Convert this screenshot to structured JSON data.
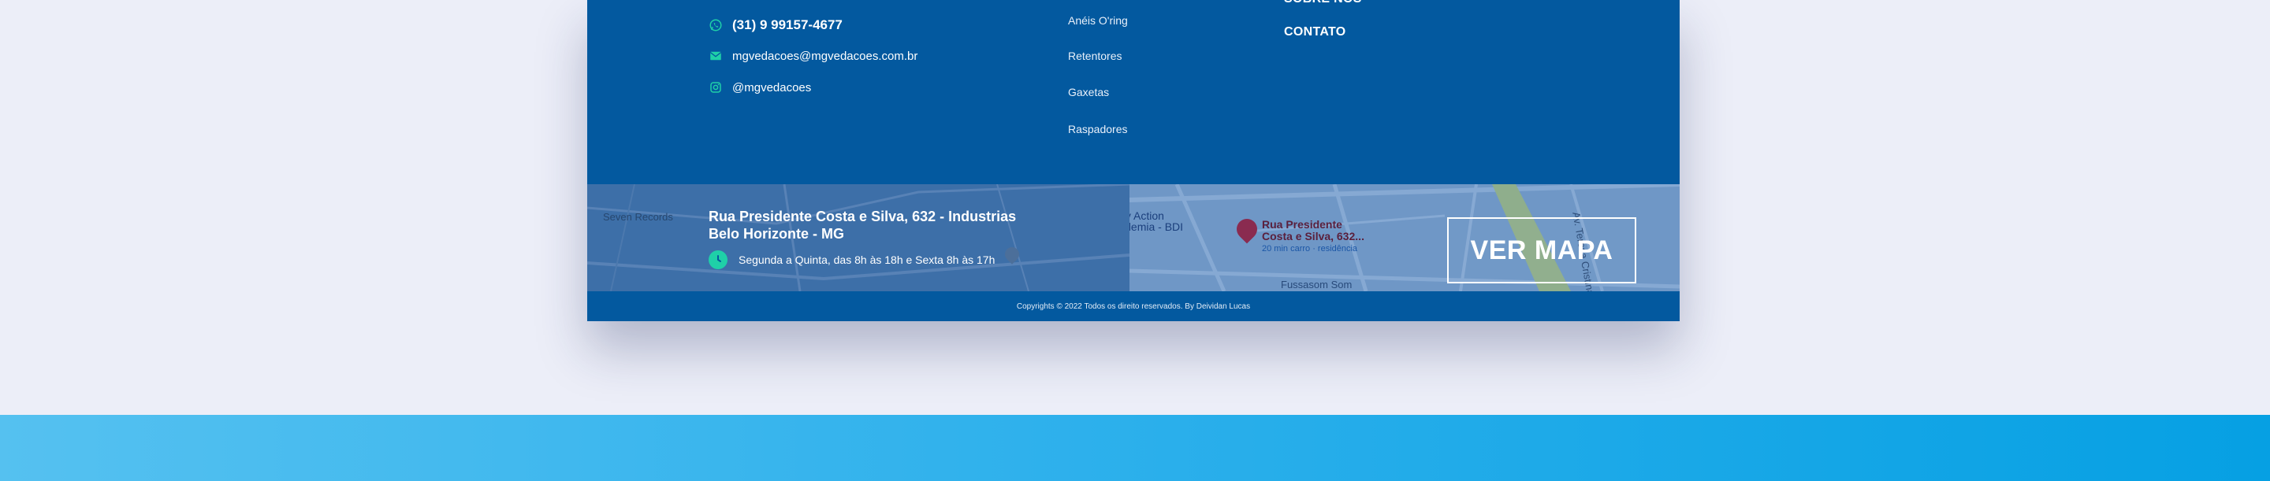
{
  "contacts": {
    "phone": "(31) 9 99157-4677",
    "email": "mgvedacoes@mgvedacoes.com.br",
    "instagram": "@mgvedacoes"
  },
  "products": [
    "Anéis O'ring",
    "Retentores",
    "Gaxetas",
    "Raspadores"
  ],
  "institutional": {
    "cut_label": "SOBRE NÓS",
    "contact_label": "CONTATO"
  },
  "location": {
    "address_line1": "Rua Presidente Costa e Silva, 632 - Industrias",
    "address_line2": "Belo Horizonte - MG",
    "hours": "Segunda a Quinta, das 8h às 18h e Sexta 8h às 17h"
  },
  "map": {
    "place_line1": "Rua Presidente",
    "place_line2": "Costa e Silva, 632...",
    "place_sub": "20 min carro · residência",
    "poi1": "Seven Records",
    "poi2": "Body Action",
    "poi3": "Academia - BDI",
    "road1": "Fussasom Som",
    "road2": "Av. Teresa Cristina",
    "button_label": "VER MAPA"
  },
  "footer": {
    "copyright": "Copyrights © 2022 Todos os direito reservados. By Deividan Lucas"
  },
  "colors": {
    "footer_bg": "#03599f",
    "accent": "#1fd0a8",
    "page_bg": "#eceef8"
  }
}
